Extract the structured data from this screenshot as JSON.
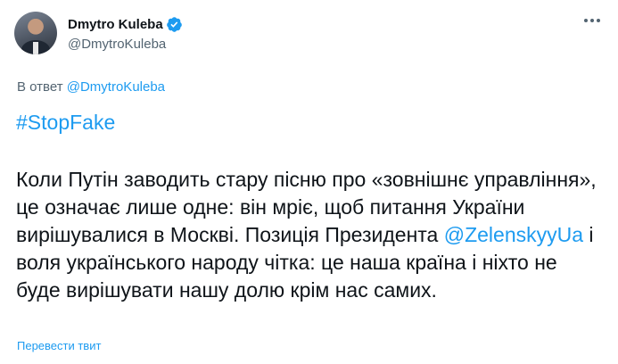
{
  "author": {
    "display_name": "Dmytro Kuleba",
    "handle": "@DmytroKuleba",
    "verified": true,
    "avatar_icon": "profile-photo"
  },
  "reply": {
    "prefix": "В ответ ",
    "to": "@DmytroKuleba"
  },
  "tweet": {
    "hashtag": "#StopFake",
    "text_before_mention": "Коли Путін заводить стару пісню про «зовнішнє управління», це означає лише одне: він мріє, щоб питання України вирішувалися в Москві. Позиція Президента ",
    "mention": "@ZelenskyyUa",
    "text_after_mention": " і воля українського народу чітка: це наша країна і ніхто не буде вирішувати нашу долю крім нас самих."
  },
  "translate_label": "Перевести твит",
  "colors": {
    "accent": "#1d9bf0",
    "text": "#0f1419",
    "secondary": "#536471"
  }
}
